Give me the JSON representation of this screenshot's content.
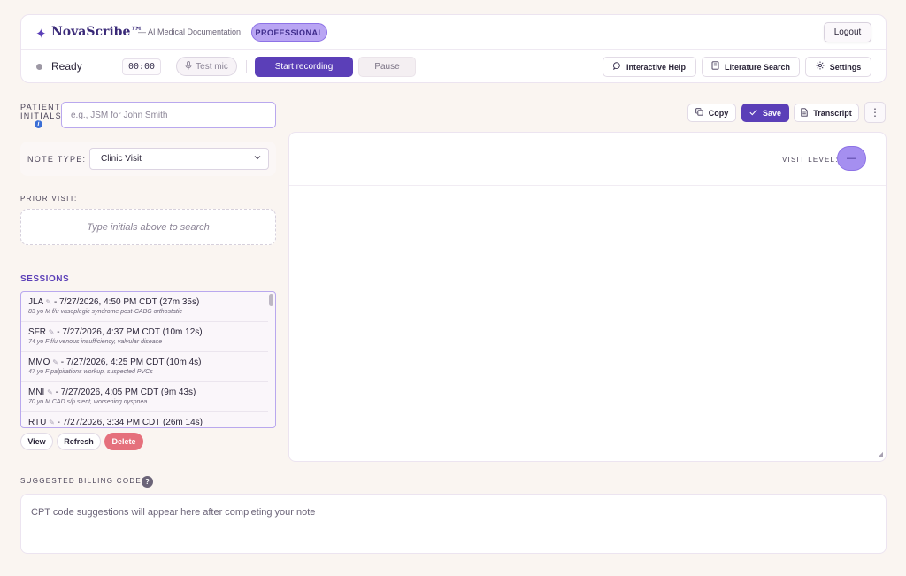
{
  "app": {
    "brand_star": "✦",
    "name": "NovaScribe™",
    "subtitle": "— AI Medical Documentation",
    "plan": "PROFESSIONAL",
    "logout": "Logout"
  },
  "toolbar": {
    "status": "Ready",
    "timer": "00:00",
    "test_mic": "Test mic",
    "start": "Start recording",
    "pause": "Pause",
    "help": "Interactive Help",
    "literature": "Literature Search",
    "settings": "Settings"
  },
  "patient": {
    "label_line1": "PATIENT",
    "label_line2": "INITIALS",
    "placeholder": "e.g., JSM for John Smith"
  },
  "note_type": {
    "label": "NOTE TYPE:",
    "selected": "Clinic Visit"
  },
  "prior_visit": {
    "label": "PRIOR VISIT:",
    "placeholder": "Type initials above to search"
  },
  "sessions": {
    "title": "SESSIONS",
    "items": [
      {
        "initials": "JLA",
        "time": "- 7/27/2026, 4:50 PM CDT (27m 35s)",
        "desc": "83 yo M f/u vasoplegic syndrome post-CABG orthostatic"
      },
      {
        "initials": "SFR",
        "time": "- 7/27/2026, 4:37 PM CDT (10m 12s)",
        "desc": "74 yo F f/u venous insufficiency, valvular disease"
      },
      {
        "initials": "MMO",
        "time": "- 7/27/2026, 4:25 PM CDT (10m 4s)",
        "desc": "47 yo F palpitations workup, suspected PVCs"
      },
      {
        "initials": "MNI",
        "time": "- 7/27/2026, 4:05 PM CDT (9m 43s)",
        "desc": "70 yo M CAD s/p stent, worsening dyspnea"
      },
      {
        "initials": "RTU",
        "time": "- 7/27/2026, 3:34 PM CDT (26m 14s)",
        "desc": ""
      }
    ],
    "view": "View",
    "refresh": "Refresh",
    "delete": "Delete"
  },
  "editor": {
    "copy": "Copy",
    "save": "Save",
    "transcript": "Transcript",
    "more": "⋮",
    "visit_level_label": "VISIT LEVEL:",
    "visit_level_value": "—"
  },
  "billing": {
    "label": "SUGGESTED BILLING CODES",
    "help": "?",
    "placeholder": "CPT code suggestions will appear here after completing your note"
  },
  "colors": {
    "accent": "#5b3fb8",
    "badge": "#b9a5f3",
    "delete": "#e5707c",
    "background": "#faf5f1"
  }
}
